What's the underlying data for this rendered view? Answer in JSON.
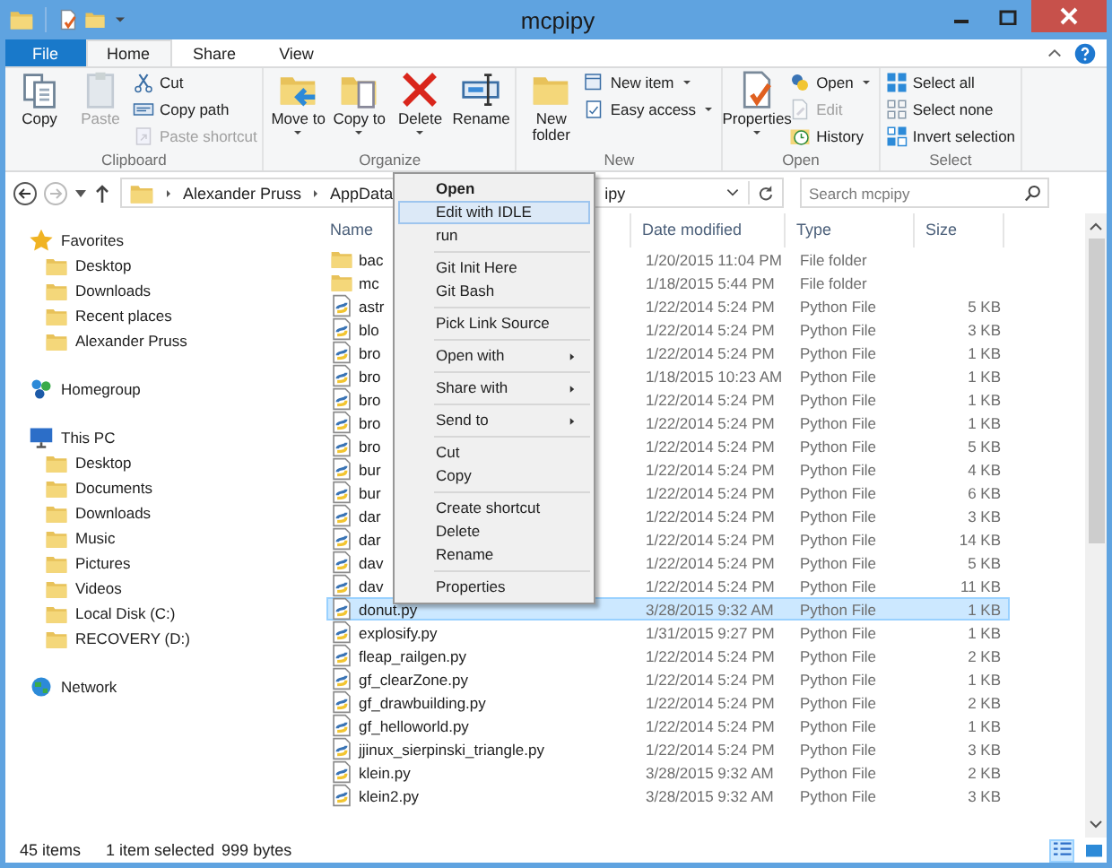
{
  "window": {
    "title": "mcpipy"
  },
  "ribbon": {
    "tabs": [
      {
        "label": "File",
        "kind": "file",
        "selected": false
      },
      {
        "label": "Home",
        "kind": "tab",
        "selected": true
      },
      {
        "label": "Share",
        "kind": "tab",
        "selected": false
      },
      {
        "label": "View",
        "kind": "tab",
        "selected": false
      }
    ],
    "groups": [
      {
        "label": "Clipboard",
        "buttons": [
          {
            "label": "Copy",
            "kind": "large",
            "disabled": false,
            "dropdown": false
          },
          {
            "label": "Paste",
            "kind": "large",
            "disabled": true,
            "dropdown": false
          },
          {
            "label": "Cut",
            "kind": "small",
            "disabled": false,
            "dropdown": false
          },
          {
            "label": "Copy path",
            "kind": "small",
            "disabled": false,
            "dropdown": false
          },
          {
            "label": "Paste shortcut",
            "kind": "small",
            "disabled": true,
            "dropdown": false
          }
        ]
      },
      {
        "label": "Organize",
        "buttons": [
          {
            "label": "Move to",
            "kind": "large",
            "disabled": false,
            "dropdown": true
          },
          {
            "label": "Copy to",
            "kind": "large",
            "disabled": false,
            "dropdown": true
          },
          {
            "label": "Delete",
            "kind": "large",
            "disabled": false,
            "dropdown": true
          },
          {
            "label": "Rename",
            "kind": "large",
            "disabled": false,
            "dropdown": false
          }
        ]
      },
      {
        "label": "New",
        "buttons": [
          {
            "label": "New folder",
            "kind": "large",
            "disabled": false,
            "dropdown": false
          },
          {
            "label": "New item",
            "kind": "small",
            "disabled": false,
            "dropdown": true
          },
          {
            "label": "Easy access",
            "kind": "small",
            "disabled": false,
            "dropdown": true
          }
        ]
      },
      {
        "label": "Open",
        "buttons": [
          {
            "label": "Properties",
            "kind": "large",
            "disabled": false,
            "dropdown": true
          },
          {
            "label": "Open",
            "kind": "small",
            "disabled": false,
            "dropdown": true
          },
          {
            "label": "Edit",
            "kind": "small",
            "disabled": true,
            "dropdown": false
          },
          {
            "label": "History",
            "kind": "small",
            "disabled": false,
            "dropdown": false
          }
        ]
      },
      {
        "label": "Select",
        "buttons": [
          {
            "label": "Select all",
            "kind": "small",
            "disabled": false,
            "dropdown": false
          },
          {
            "label": "Select none",
            "kind": "small",
            "disabled": false,
            "dropdown": false
          },
          {
            "label": "Invert selection",
            "kind": "small",
            "disabled": false,
            "dropdown": false
          }
        ]
      }
    ]
  },
  "address_bar": {
    "crumbs": [
      "Alexander Pruss",
      "AppData",
      "ipy"
    ]
  },
  "search": {
    "placeholder": "Search mcpipy"
  },
  "sidebar": {
    "items": [
      {
        "label": "Favorites",
        "children": [
          {
            "label": "Desktop"
          },
          {
            "label": "Downloads"
          },
          {
            "label": "Recent places"
          },
          {
            "label": "Alexander Pruss"
          }
        ]
      },
      {
        "label": "Homegroup"
      },
      {
        "label": "This PC",
        "children": [
          {
            "label": "Desktop"
          },
          {
            "label": "Documents"
          },
          {
            "label": "Downloads"
          },
          {
            "label": "Music"
          },
          {
            "label": "Pictures"
          },
          {
            "label": "Videos"
          },
          {
            "label": "Local Disk (C:)"
          },
          {
            "label": "RECOVERY (D:)"
          }
        ]
      },
      {
        "label": "Network"
      }
    ]
  },
  "file_list": {
    "columns": [
      "Name",
      "Date modified",
      "Type",
      "Size"
    ],
    "rows": [
      {
        "name": "bac",
        "date": "1/20/2015 11:04 PM",
        "type": "File folder",
        "size": "",
        "kind": "folder",
        "selected": false
      },
      {
        "name": "mc",
        "date": "1/18/2015 5:44 PM",
        "type": "File folder",
        "size": "",
        "kind": "folder",
        "selected": false
      },
      {
        "name": "astr",
        "date": "1/22/2014 5:24 PM",
        "type": "Python File",
        "size": "5 KB",
        "kind": "python",
        "selected": false
      },
      {
        "name": "blo",
        "date": "1/22/2014 5:24 PM",
        "type": "Python File",
        "size": "3 KB",
        "kind": "python",
        "selected": false
      },
      {
        "name": "bro",
        "date": "1/22/2014 5:24 PM",
        "type": "Python File",
        "size": "1 KB",
        "kind": "python",
        "selected": false
      },
      {
        "name": "bro",
        "date": "1/18/2015 10:23 AM",
        "type": "Python File",
        "size": "1 KB",
        "kind": "python",
        "selected": false
      },
      {
        "name": "bro",
        "date": "1/22/2014 5:24 PM",
        "type": "Python File",
        "size": "1 KB",
        "kind": "python",
        "selected": false
      },
      {
        "name": "bro",
        "date": "1/22/2014 5:24 PM",
        "type": "Python File",
        "size": "1 KB",
        "kind": "python",
        "selected": false
      },
      {
        "name": "bro",
        "date": "1/22/2014 5:24 PM",
        "type": "Python File",
        "size": "5 KB",
        "kind": "python",
        "selected": false
      },
      {
        "name": "bur",
        "date": "1/22/2014 5:24 PM",
        "type": "Python File",
        "size": "4 KB",
        "kind": "python",
        "selected": false
      },
      {
        "name": "bur",
        "date": "1/22/2014 5:24 PM",
        "type": "Python File",
        "size": "6 KB",
        "kind": "python",
        "selected": false
      },
      {
        "name": "dar",
        "date": "1/22/2014 5:24 PM",
        "type": "Python File",
        "size": "3 KB",
        "kind": "python",
        "selected": false
      },
      {
        "name": "dar",
        "date": "1/22/2014 5:24 PM",
        "type": "Python File",
        "size": "14 KB",
        "kind": "python",
        "selected": false
      },
      {
        "name": "dav",
        "date": "1/22/2014 5:24 PM",
        "type": "Python File",
        "size": "5 KB",
        "kind": "python",
        "selected": false
      },
      {
        "name": "dav",
        "date": "1/22/2014 5:24 PM",
        "type": "Python File",
        "size": "11 KB",
        "kind": "python",
        "selected": false
      },
      {
        "name": "donut.py",
        "date": "3/28/2015 9:32 AM",
        "type": "Python File",
        "size": "1 KB",
        "kind": "python",
        "selected": true
      },
      {
        "name": "explosify.py",
        "date": "1/31/2015 9:27 PM",
        "type": "Python File",
        "size": "1 KB",
        "kind": "python",
        "selected": false
      },
      {
        "name": "fleap_railgen.py",
        "date": "1/22/2014 5:24 PM",
        "type": "Python File",
        "size": "2 KB",
        "kind": "python",
        "selected": false
      },
      {
        "name": "gf_clearZone.py",
        "date": "1/22/2014 5:24 PM",
        "type": "Python File",
        "size": "1 KB",
        "kind": "python",
        "selected": false
      },
      {
        "name": "gf_drawbuilding.py",
        "date": "1/22/2014 5:24 PM",
        "type": "Python File",
        "size": "2 KB",
        "kind": "python",
        "selected": false
      },
      {
        "name": "gf_helloworld.py",
        "date": "1/22/2014 5:24 PM",
        "type": "Python File",
        "size": "1 KB",
        "kind": "python",
        "selected": false
      },
      {
        "name": "jjinux_sierpinski_triangle.py",
        "date": "1/22/2014 5:24 PM",
        "type": "Python File",
        "size": "3 KB",
        "kind": "python",
        "selected": false
      },
      {
        "name": "klein.py",
        "date": "3/28/2015 9:32 AM",
        "type": "Python File",
        "size": "2 KB",
        "kind": "python",
        "selected": false
      },
      {
        "name": "klein2.py",
        "date": "3/28/2015 9:32 AM",
        "type": "Python File",
        "size": "3 KB",
        "kind": "python",
        "selected": false
      }
    ]
  },
  "context_menu": {
    "items": [
      {
        "kind": "item",
        "label": "Open",
        "default": true,
        "submenu": false,
        "selected": false
      },
      {
        "kind": "item",
        "label": "Edit with IDLE",
        "default": false,
        "submenu": false,
        "selected": true
      },
      {
        "kind": "item",
        "label": "run",
        "default": false,
        "submenu": false,
        "selected": false
      },
      {
        "kind": "separator"
      },
      {
        "kind": "item",
        "label": "Git Init Here",
        "default": false,
        "submenu": false,
        "selected": false
      },
      {
        "kind": "item",
        "label": "Git Bash",
        "default": false,
        "submenu": false,
        "selected": false
      },
      {
        "kind": "separator"
      },
      {
        "kind": "item",
        "label": "Pick Link Source",
        "default": false,
        "submenu": false,
        "selected": false
      },
      {
        "kind": "separator"
      },
      {
        "kind": "item",
        "label": "Open with",
        "default": false,
        "submenu": true,
        "selected": false
      },
      {
        "kind": "separator"
      },
      {
        "kind": "item",
        "label": "Share with",
        "default": false,
        "submenu": true,
        "selected": false
      },
      {
        "kind": "separator"
      },
      {
        "kind": "item",
        "label": "Send to",
        "default": false,
        "submenu": true,
        "selected": false
      },
      {
        "kind": "separator"
      },
      {
        "kind": "item",
        "label": "Cut",
        "default": false,
        "submenu": false,
        "selected": false
      },
      {
        "kind": "item",
        "label": "Copy",
        "default": false,
        "submenu": false,
        "selected": false
      },
      {
        "kind": "separator"
      },
      {
        "kind": "item",
        "label": "Create shortcut",
        "default": false,
        "submenu": false,
        "selected": false
      },
      {
        "kind": "item",
        "label": "Delete",
        "default": false,
        "submenu": false,
        "selected": false
      },
      {
        "kind": "item",
        "label": "Rename",
        "default": false,
        "submenu": false,
        "selected": false
      },
      {
        "kind": "separator"
      },
      {
        "kind": "item",
        "label": "Properties",
        "default": false,
        "submenu": false,
        "selected": false
      }
    ]
  },
  "status_bar": {
    "item_count": "45 items",
    "selection": "1 item selected",
    "selection_size": "999 bytes"
  },
  "view_buttons": [
    {
      "selected": true
    },
    {
      "selected": false
    }
  ]
}
